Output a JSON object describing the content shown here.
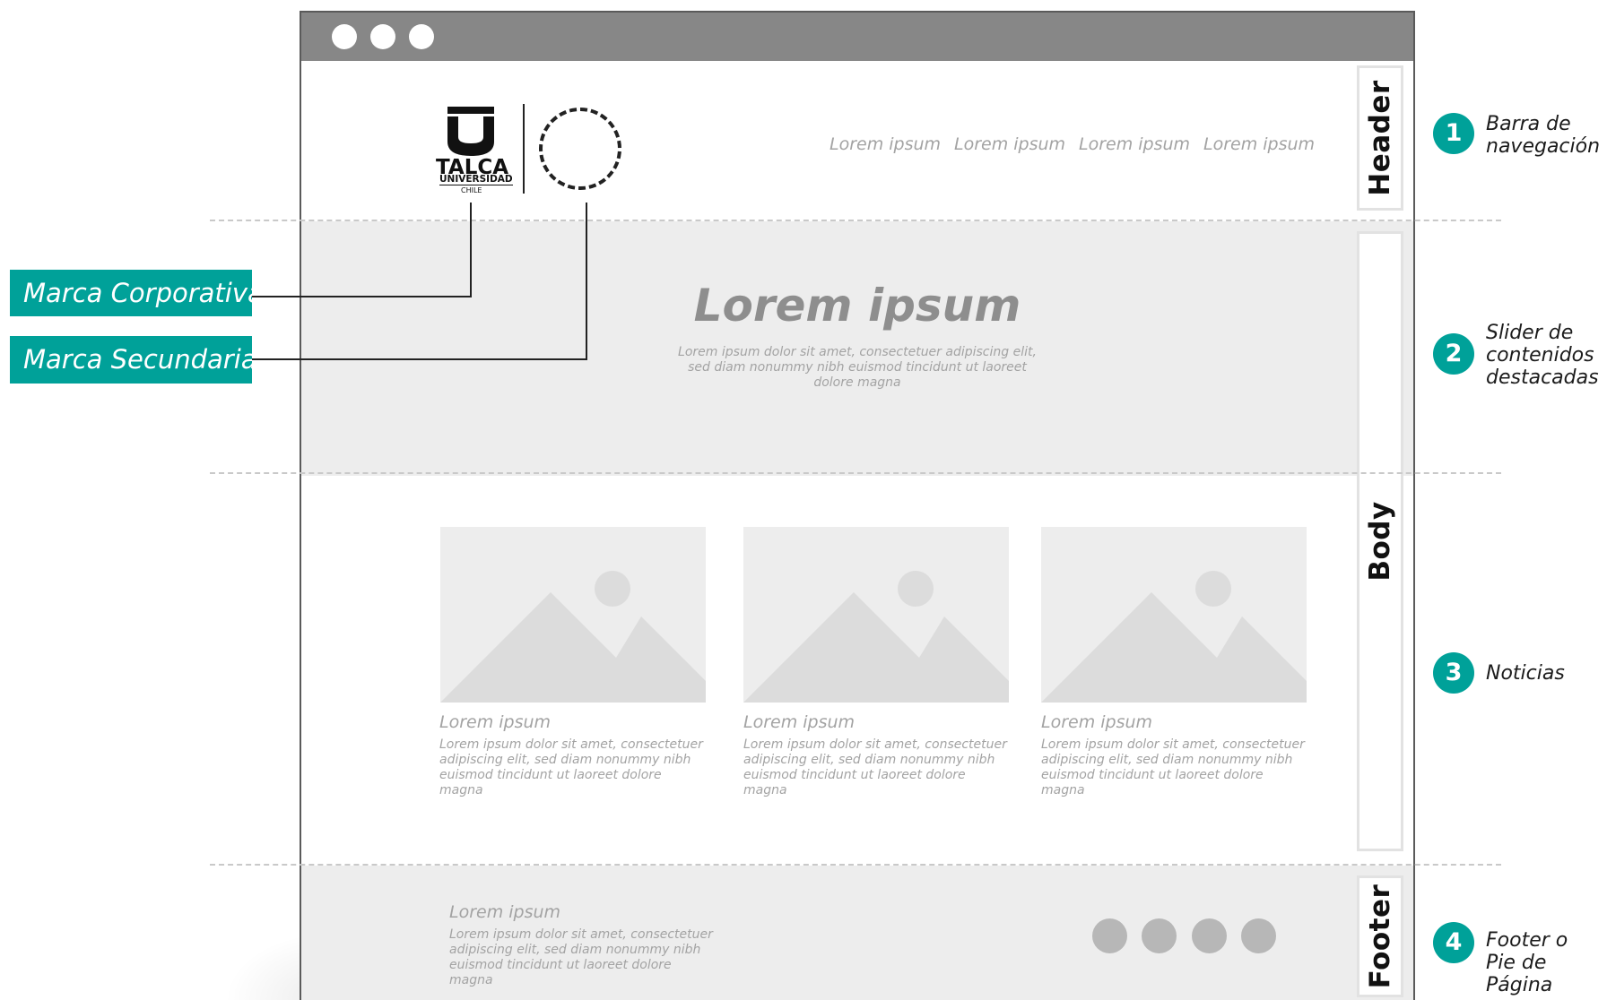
{
  "header": {
    "nav_links": [
      "Lorem ipsum",
      "Lorem ipsum",
      "Lorem ipsum",
      "Lorem ipsum"
    ],
    "logo": {
      "main": "TALCA",
      "sub": "UNIVERSIDAD",
      "country": "CHILE"
    }
  },
  "slider": {
    "title": "Lorem ipsum",
    "text": "Lorem ipsum dolor sit amet, consectetuer adipiscing elit, sed diam nonummy nibh euismod tincidunt ut laoreet dolore magna"
  },
  "news": [
    {
      "title": "Lorem ipsum",
      "text": "Lorem ipsum dolor sit amet, consectetuer adipiscing elit, sed diam nonummy nibh euismod tincidunt ut laoreet dolore magna"
    },
    {
      "title": "Lorem ipsum",
      "text": "Lorem ipsum dolor sit amet, consectetuer adipiscing elit, sed diam nonummy nibh euismod tincidunt ut laoreet dolore magna"
    },
    {
      "title": "Lorem ipsum",
      "text": "Lorem ipsum dolor sit amet, consectetuer adipiscing elit, sed diam nonummy nibh euismod tincidunt ut laoreet dolore magna"
    }
  ],
  "footer": {
    "title": "Lorem ipsum",
    "text": "Lorem ipsum dolor sit amet, consectetuer adipiscing elit, sed diam nonummy nibh euismod tincidunt ut laoreet dolore magna"
  },
  "section_labels": {
    "header": "Header",
    "body": "Body",
    "footer": "Footer"
  },
  "callouts": {
    "corporate": "Marca Corporativa",
    "secondary": "Marca Secundaria"
  },
  "annotations": [
    {
      "number": "1",
      "line1": "Barra de",
      "line2": "navegación",
      "line3": ""
    },
    {
      "number": "2",
      "line1": "Slider de",
      "line2": "contenidos",
      "line3": "destacadas"
    },
    {
      "number": "3",
      "line1": "Noticias",
      "line2": "",
      "line3": ""
    },
    {
      "number": "4",
      "line1": "Footer o",
      "line2": "Pie de Página",
      "line3": ""
    }
  ],
  "colors": {
    "accent": "#00a199",
    "window_bar": "#878787",
    "band": "#ededed"
  }
}
